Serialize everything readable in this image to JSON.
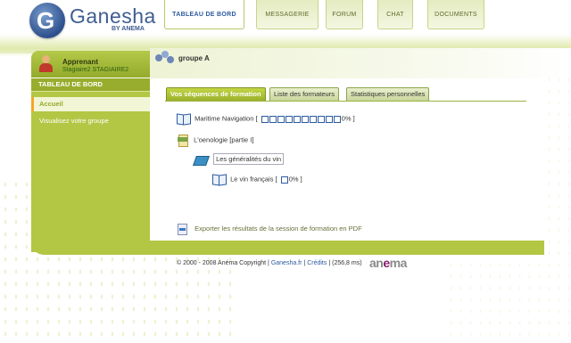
{
  "logo": {
    "name": "Ganesha",
    "sub": "BY ANEMA",
    "letter": "G"
  },
  "nav": {
    "tabs": [
      {
        "label": "TABLEAU DE BORD",
        "active": true
      },
      {
        "label": "MESSAGERIE",
        "active": false
      },
      {
        "label": "FORUM",
        "active": false
      },
      {
        "label": "CHAT",
        "active": false
      },
      {
        "label": "DOCUMENTS",
        "active": false
      }
    ]
  },
  "user": {
    "role": "Apprenant",
    "name": "Stagiaire2 STAGIAIRE2"
  },
  "sidebar": {
    "heading": "TABLEAU DE BORD",
    "items": [
      {
        "label": "Accueil",
        "active": true
      },
      {
        "label": "Visualisez votre groupe",
        "active": false
      }
    ]
  },
  "group": {
    "title": "groupe A"
  },
  "subtabs": [
    {
      "label": "Vos séquences de formation",
      "active": true
    },
    {
      "label": "Liste des formateurs",
      "active": false
    },
    {
      "label": "Statistiques personnelles",
      "active": false
    }
  ],
  "courses": {
    "maritime": {
      "title": "Maritime Navigation",
      "percent": "0%",
      "progress_fraction": 0
    },
    "oenologie": {
      "title": "L'oenologie [partie I]"
    },
    "generalites": {
      "title": "Les généralités du vin"
    },
    "vin_francais": {
      "title": "Le vin français",
      "percent": "0%",
      "progress_fraction": 0
    }
  },
  "export": {
    "label": "Exporter les résultats de la session de formation en PDF"
  },
  "footer": {
    "copyright": "© 2000 - 2008 Anéma Copyright |",
    "link1": "Ganesha.fr",
    "sep": "|",
    "link2": "Crédits",
    "timing": "| (256,8 ms)"
  },
  "footer_logo": {
    "text": "anema"
  },
  "colors": {
    "accent": "#b3c744",
    "accent_dark": "#93ab2b",
    "link_blue": "#2c5aa0",
    "active_marker": "#f5a623"
  }
}
